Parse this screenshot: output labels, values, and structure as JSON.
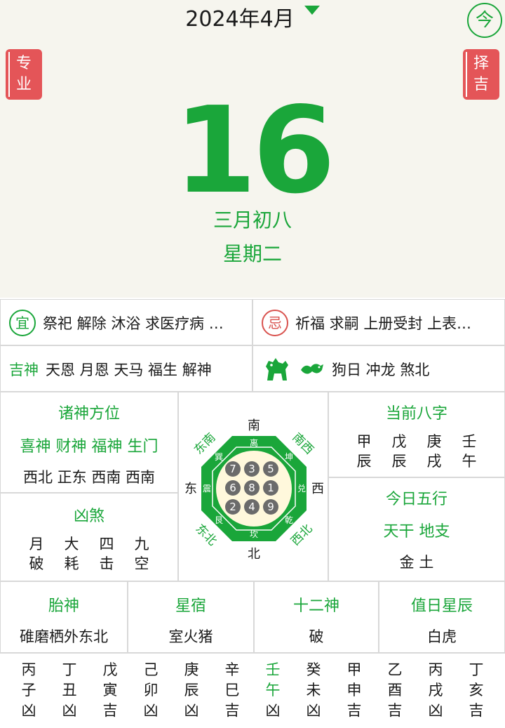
{
  "header": {
    "month": "2024年4月",
    "today_btn": "今",
    "pro_tag": [
      "专",
      "业"
    ],
    "ze_tag": [
      "择",
      "吉"
    ]
  },
  "day": {
    "number": "16",
    "lunar": "三月初八",
    "weekday": "星期二"
  },
  "yi": {
    "icon": "宜",
    "text": "祭祀 解除 沐浴 求医疗病 …"
  },
  "ji": {
    "icon": "忌",
    "text": "祈福 求嗣 上册受封 上表…"
  },
  "jishen": {
    "label": "吉神",
    "text": "天恩 月恩 天马 福生 解神"
  },
  "chong": {
    "text": "狗日 冲龙 煞北"
  },
  "zhushen": {
    "title": "诸神方位",
    "names": "喜神 财神 福神 生门",
    "dirs": "西北 正东 西南 西南"
  },
  "xiongsha": {
    "title": "凶煞",
    "top": [
      "月",
      "大",
      "四",
      "九"
    ],
    "bottom": [
      "破",
      "耗",
      "击",
      "空"
    ]
  },
  "bagua": {
    "top": "南",
    "bottom": "北",
    "left": "东",
    "right": "西",
    "ne": "东南",
    "nw": "南西",
    "se": "东北",
    "sw": "西北",
    "li": "离",
    "kun": "坤",
    "dui": "兑",
    "qian": "乾",
    "kan": "坎",
    "gen": "艮",
    "zhen": "震",
    "xun": "巽",
    "nums": [
      "7",
      "3",
      "5",
      "6",
      "8",
      "1",
      "2",
      "4",
      "9"
    ]
  },
  "bazi": {
    "title": "当前八字",
    "top": [
      "甲",
      "戊",
      "庚",
      "壬"
    ],
    "bottom": [
      "辰",
      "辰",
      "戌",
      "午"
    ]
  },
  "wuxing": {
    "title": "今日五行",
    "sub": "天干 地支",
    "val": "金 土"
  },
  "row4": [
    {
      "title": "胎神",
      "val": "碓磨栖外东北"
    },
    {
      "title": "星宿",
      "val": "室火猪"
    },
    {
      "title": "十二神",
      "val": "破"
    },
    {
      "title": "值日星辰",
      "val": "白虎"
    }
  ],
  "hours": [
    {
      "gan": "丙",
      "zhi": "子",
      "luck": "凶",
      "current": false
    },
    {
      "gan": "丁",
      "zhi": "丑",
      "luck": "凶",
      "current": false
    },
    {
      "gan": "戊",
      "zhi": "寅",
      "luck": "吉",
      "current": false
    },
    {
      "gan": "己",
      "zhi": "卯",
      "luck": "凶",
      "current": false
    },
    {
      "gan": "庚",
      "zhi": "辰",
      "luck": "凶",
      "current": false
    },
    {
      "gan": "辛",
      "zhi": "巳",
      "luck": "吉",
      "current": false
    },
    {
      "gan": "壬",
      "zhi": "午",
      "luck": "凶",
      "current": true
    },
    {
      "gan": "癸",
      "zhi": "未",
      "luck": "凶",
      "current": false
    },
    {
      "gan": "甲",
      "zhi": "申",
      "luck": "吉",
      "current": false
    },
    {
      "gan": "乙",
      "zhi": "酉",
      "luck": "吉",
      "current": false
    },
    {
      "gan": "丙",
      "zhi": "戌",
      "luck": "凶",
      "current": false
    },
    {
      "gan": "丁",
      "zhi": "亥",
      "luck": "吉",
      "current": false
    }
  ],
  "colors": {
    "green": "#1aa63a",
    "red": "#e45558",
    "top_bg": "#f6f5ee"
  }
}
